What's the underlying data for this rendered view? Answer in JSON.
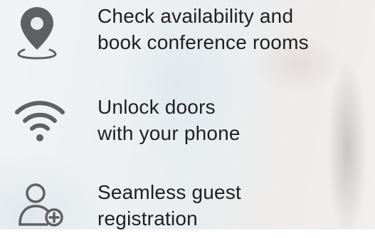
{
  "features": [
    {
      "icon": "location-pin-icon",
      "line1": "Check availability and",
      "line2": "book conference rooms"
    },
    {
      "icon": "wifi-icon",
      "line1": "Unlock doors",
      "line2": "with your phone"
    },
    {
      "icon": "add-user-icon",
      "line1": "Seamless guest",
      "line2": "registration"
    }
  ],
  "colors": {
    "icon": "#5f6062",
    "text": "#1f1f1f"
  }
}
